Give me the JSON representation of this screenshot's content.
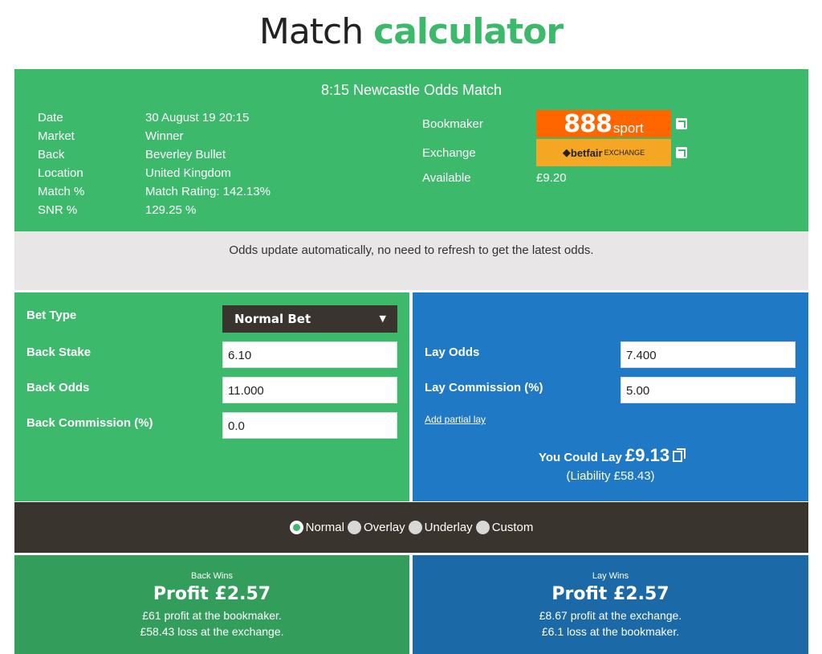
{
  "header": {
    "title_plain": "Match",
    "title_accent": "calculator"
  },
  "info": {
    "title": "8:15 Newcastle Odds Match",
    "rows": [
      {
        "key": "Date",
        "value": "30 August 19 20:15"
      },
      {
        "key": "Market",
        "value": "Winner"
      },
      {
        "key": "Back",
        "value": "Beverley Bullet"
      },
      {
        "key": "Location",
        "value": "United Kingdom"
      },
      {
        "key": "Match %",
        "value": "Match Rating: 142.13%"
      },
      {
        "key": "SNR %",
        "value": "129.25 %"
      }
    ],
    "bookmaker_label": "Bookmaker",
    "bookmaker_logo_big": "888",
    "bookmaker_logo_small": "sport",
    "exchange_label": "Exchange",
    "exchange_logo_main": "betfair",
    "exchange_logo_sub": "EXCHANGE",
    "available_label": "Available",
    "available_value": "£9.20"
  },
  "notice": "Odds update automatically, no need to refresh to get the latest odds.",
  "back": {
    "bet_type_label": "Bet Type",
    "bet_type_value": "Normal Bet",
    "stake_label": "Back Stake",
    "stake_value": "6.10",
    "odds_label": "Back Odds",
    "odds_value": "11.000",
    "commission_label": "Back Commission (%)",
    "commission_value": "0.0"
  },
  "lay": {
    "odds_label": "Lay Odds",
    "odds_value": "7.400",
    "commission_label": "Lay Commission (%)",
    "commission_value": "5.00",
    "partial_link": "Add partial lay",
    "could_lay_text": "You Could Lay",
    "could_lay_amount": "£9.13",
    "liability": "(Liability £58.43)"
  },
  "modes": [
    {
      "label": "Normal",
      "selected": true
    },
    {
      "label": "Overlay",
      "selected": false
    },
    {
      "label": "Underlay",
      "selected": false
    },
    {
      "label": "Custom",
      "selected": false
    }
  ],
  "results": {
    "back": {
      "heading": "Back Wins",
      "profit": "Profit £2.57",
      "line1": "£61 profit at the bookmaker.",
      "line2": "£58.43 loss at the exchange."
    },
    "lay": {
      "heading": "Lay Wins",
      "profit": "Profit £2.57",
      "line1": "£8.67 profit at the exchange.",
      "line2": "£6.1 loss at the bookmaker."
    }
  },
  "colors": {
    "green": "#3cb96b",
    "blue": "#2079c4",
    "dark": "#3a342e",
    "orange": "#ff6600",
    "betfair": "#f5a623"
  }
}
